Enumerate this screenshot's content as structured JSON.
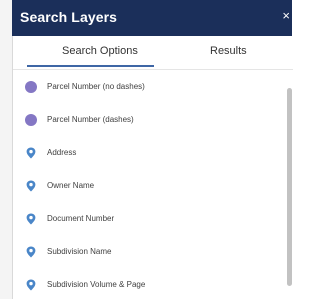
{
  "panel": {
    "title": "Search Layers",
    "close_glyph": "×"
  },
  "tabs": [
    {
      "label": "Search Options",
      "active": true
    },
    {
      "label": "Results",
      "active": false
    }
  ],
  "options": [
    {
      "label": "Parcel Number (no dashes)",
      "icon": "circle-icon"
    },
    {
      "label": "Parcel Number (dashes)",
      "icon": "circle-icon"
    },
    {
      "label": "Address",
      "icon": "map-pin-icon"
    },
    {
      "label": "Owner Name",
      "icon": "map-pin-icon"
    },
    {
      "label": "Document Number",
      "icon": "map-pin-icon"
    },
    {
      "label": "Subdivision Name",
      "icon": "map-pin-icon"
    },
    {
      "label": "Subdivision Volume & Page",
      "icon": "map-pin-icon"
    }
  ],
  "colors": {
    "header_bg": "#1b2f5a",
    "active_tab_underline": "#3e66a5",
    "circle_icon": "#8477c4",
    "pin_icon": "#4a86c8"
  }
}
